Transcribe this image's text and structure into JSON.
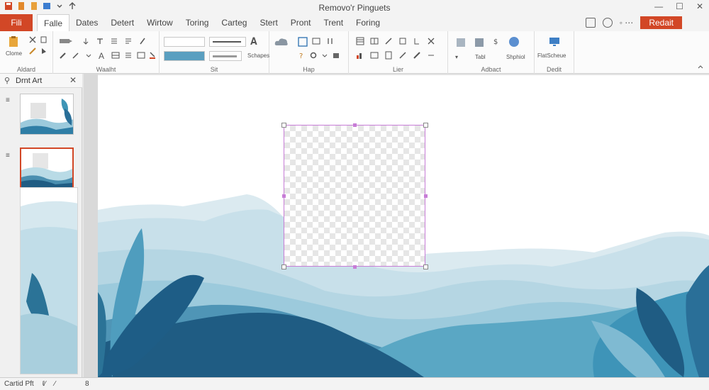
{
  "window": {
    "title": "Removo'r Pinguets",
    "qat_icons": [
      "save-icon",
      "undo-icon",
      "redo-icon",
      "open-icon",
      "share-icon"
    ],
    "controls": [
      "minimize-icon",
      "maximize-icon",
      "close-icon"
    ]
  },
  "menu": {
    "file_label": "Fili",
    "tabs": [
      "Falle",
      "Dates",
      "Detert",
      "Wirtow",
      "Toring",
      "Carteg",
      "Stert",
      "Pront",
      "Trent",
      "Foring"
    ],
    "active_tab": 0,
    "restart_label": "Redait"
  },
  "ribbon": {
    "groups": [
      {
        "label": "Aldard"
      },
      {
        "label": "Waalht"
      },
      {
        "label": "Sit"
      },
      {
        "label": "Hap"
      },
      {
        "label": "Lier"
      },
      {
        "label": "Adbact"
      },
      {
        "label": "Dedit"
      }
    ],
    "texts": {
      "clone": "Clome",
      "schapes": "Schapes",
      "tabl": "Tabl",
      "shphiol": "Shphiol",
      "flatschenue": "FlatScheue"
    }
  },
  "pane": {
    "title": "Drnt Art",
    "slides": [
      {
        "selected": false
      },
      {
        "selected": true
      }
    ]
  },
  "status": {
    "left": "Cartid Pft",
    "right": "8"
  },
  "colors": {
    "accent": "#d24726",
    "selection": "#c77dd6",
    "teal_dark": "#1f5c83",
    "teal_mid": "#4a8fb0",
    "teal_light": "#9ccadc",
    "mist": "#d6e8ef"
  }
}
